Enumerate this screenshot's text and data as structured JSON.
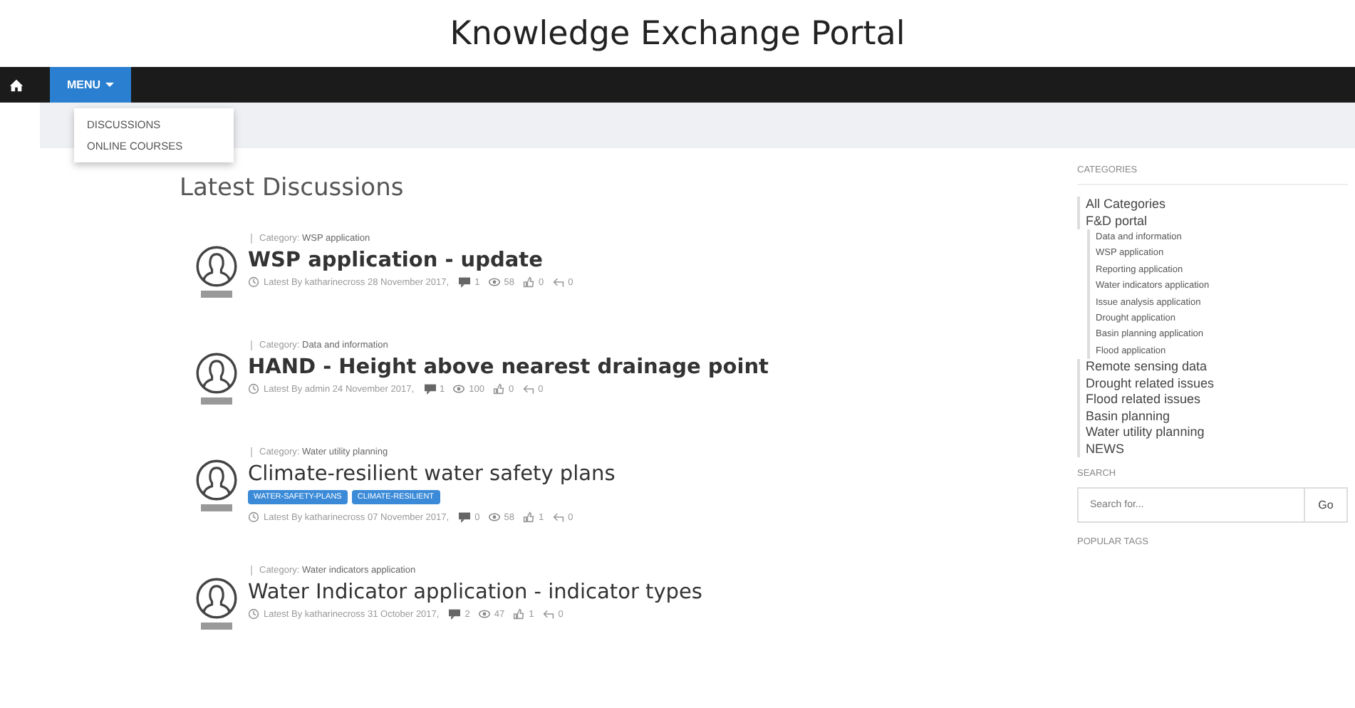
{
  "header": {
    "title": "Knowledge Exchange Portal"
  },
  "navbar": {
    "menu_label": "MENU",
    "menu_expanded": true,
    "menu_items": [
      "DISCUSSIONS",
      "ONLINE COURSES"
    ]
  },
  "main": {
    "heading": "Latest Discussions",
    "discussions": [
      {
        "category_label": "Category:",
        "category": "WSP application",
        "title": "WSP application - update",
        "by": "Latest By",
        "author": "katharinecross",
        "date": "28 November 2017,",
        "comments": "1",
        "views": "58",
        "likes": "0",
        "replies": "0"
      },
      {
        "category_label": "Category:",
        "category": "Data and information",
        "title": "HAND - Height above nearest drainage point",
        "by": "Latest By",
        "author": "admin",
        "date": "24 November 2017,",
        "comments": "1",
        "views": "100",
        "likes": "0",
        "replies": "0"
      },
      {
        "category_label": "Category:",
        "category": "Water utility planning",
        "title": "Climate-resilient water safety plans",
        "tags": [
          "WATER-SAFETY-PLANS",
          "CLIMATE-RESILIENT"
        ],
        "by": "Latest By",
        "author": "katharinecross",
        "date": "07 November 2017,",
        "comments": "0",
        "views": "58",
        "likes": "1",
        "replies": "0"
      },
      {
        "category_label": "Category:",
        "category": "Water indicators application",
        "title": "Water Indicator application - indicator types",
        "by": "Latest By",
        "author": "katharinecross",
        "date": "31 October 2017,",
        "comments": "2",
        "views": "47",
        "likes": "1",
        "replies": "0"
      }
    ]
  },
  "sidebar": {
    "categories_heading": "CATEGORIES",
    "categories": [
      {
        "label": "All Categories"
      },
      {
        "label": "F&D portal",
        "children": [
          {
            "label": "Data and information"
          },
          {
            "label": "WSP application"
          },
          {
            "label": "Reporting application"
          },
          {
            "label": "Water indicators application"
          },
          {
            "label": "Issue analysis application"
          },
          {
            "label": "Drought application"
          },
          {
            "label": "Basin planning application"
          },
          {
            "label": "Flood application"
          }
        ]
      },
      {
        "label": "Remote sensing data"
      },
      {
        "label": "Drought related issues"
      },
      {
        "label": "Flood related issues"
      },
      {
        "label": "Basin planning"
      },
      {
        "label": "Water utility planning"
      },
      {
        "label": "NEWS"
      }
    ],
    "search_heading": "SEARCH",
    "search_placeholder": "Search for...",
    "search_button": "Go",
    "tags_heading": "POPULAR TAGS"
  }
}
